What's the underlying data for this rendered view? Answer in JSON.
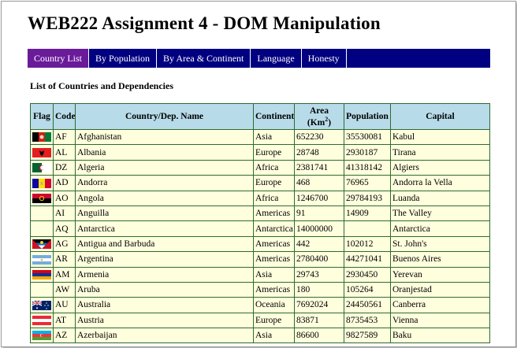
{
  "page": {
    "title": "WEB222 Assignment 4 - DOM  Manipulation",
    "subtitle": "List of Countries and  Dependencies"
  },
  "nav": [
    {
      "label": "Country List",
      "active": true
    },
    {
      "label": "By Population",
      "active": false
    },
    {
      "label": "By Area & Continent",
      "active": false
    },
    {
      "label": "Language",
      "active": false
    },
    {
      "label": "Honesty",
      "active": false
    }
  ],
  "table": {
    "headers": {
      "flag": "Flag",
      "code": "Code",
      "name": "Country/Dep. Name",
      "continent": "Continent",
      "area": "Area",
      "area_unit": "(Km",
      "area_sup": "2",
      "area_close": ")",
      "population": "Population",
      "capital": "Capital"
    },
    "rows": [
      {
        "code": "AF",
        "name": "Afghanistan",
        "continent": "Asia",
        "area": "652230",
        "population": "35530081",
        "capital": "Kabul",
        "flag": "af-flag"
      },
      {
        "code": "AL",
        "name": "Albania",
        "continent": "Europe",
        "area": "28748",
        "population": "2930187",
        "capital": "Tirana",
        "flag": "al-flag"
      },
      {
        "code": "DZ",
        "name": "Algeria",
        "continent": "Africa",
        "area": "2381741",
        "population": "41318142",
        "capital": "Algiers",
        "flag": "dz-flag"
      },
      {
        "code": "AD",
        "name": "Andorra",
        "continent": "Europe",
        "area": "468",
        "population": "76965",
        "capital": "Andorra la Vella",
        "flag": "ad-flag"
      },
      {
        "code": "AO",
        "name": "Angola",
        "continent": "Africa",
        "area": "1246700",
        "population": "29784193",
        "capital": "Luanda",
        "flag": "ao-flag"
      },
      {
        "code": "AI",
        "name": "Anguilla",
        "continent": "Americas",
        "area": "91",
        "population": "14909",
        "capital": "The Valley",
        "flag": ""
      },
      {
        "code": "AQ",
        "name": "Antarctica",
        "continent": "Antarctica",
        "area": "14000000",
        "population": "",
        "capital": "Antarctica",
        "flag": ""
      },
      {
        "code": "AG",
        "name": "Antigua and Barbuda",
        "continent": "Americas",
        "area": "442",
        "population": "102012",
        "capital": "St. John's",
        "flag": "ag-flag"
      },
      {
        "code": "AR",
        "name": "Argentina",
        "continent": "Americas",
        "area": "2780400",
        "population": "44271041",
        "capital": "Buenos Aires",
        "flag": "ar-flag"
      },
      {
        "code": "AM",
        "name": "Armenia",
        "continent": "Asia",
        "area": "29743",
        "population": "2930450",
        "capital": "Yerevan",
        "flag": "am-flag"
      },
      {
        "code": "AW",
        "name": "Aruba",
        "continent": "Americas",
        "area": "180",
        "population": "105264",
        "capital": "Oranjestad",
        "flag": ""
      },
      {
        "code": "AU",
        "name": "Australia",
        "continent": "Oceania",
        "area": "7692024",
        "population": "24450561",
        "capital": "Canberra",
        "flag": "au-flag"
      },
      {
        "code": "AT",
        "name": "Austria",
        "continent": "Europe",
        "area": "83871",
        "population": "8735453",
        "capital": "Vienna",
        "flag": "at-flag"
      },
      {
        "code": "AZ",
        "name": "Azerbaijan",
        "continent": "Asia",
        "area": "86600",
        "population": "9827589",
        "capital": "Baku",
        "flag": "az-flag"
      }
    ]
  }
}
